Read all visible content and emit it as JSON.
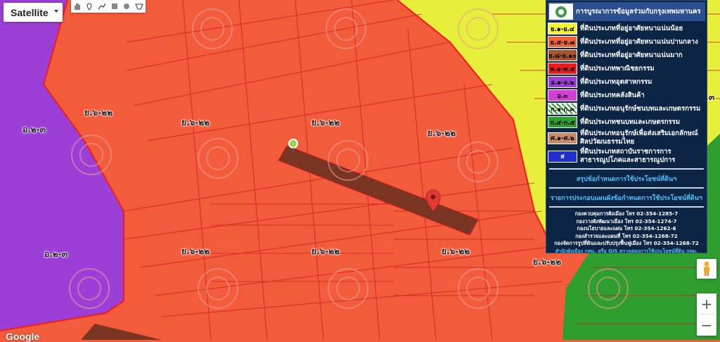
{
  "map_type": {
    "label": "Satellite"
  },
  "drawing_tools": [
    "hand-icon",
    "marker-icon",
    "polyline-icon",
    "polygon-icon",
    "circle-icon",
    "shape-icon"
  ],
  "zone_labels": [
    {
      "text": "ย.๖-๒๒",
      "id": "a"
    },
    {
      "text": "ย.๖-๒๒",
      "id": "b"
    },
    {
      "text": "ย.๖-๒๒",
      "id": "c"
    },
    {
      "text": "ย.๖-๒๒",
      "id": "d"
    },
    {
      "text": "ย.๖-๒๒",
      "id": "e"
    },
    {
      "text": "ย.๖-๒๒",
      "id": "f"
    },
    {
      "text": "ย.๖-๒๒",
      "id": "g"
    },
    {
      "text": "ย.๖-๒๒",
      "id": "h"
    },
    {
      "text": "อ.๒-๓",
      "id": "i"
    },
    {
      "text": "อ.๒-๓",
      "id": "j"
    }
  ],
  "legend": {
    "title": "การบูรณาการข้อมูลร่วมกับกรุงเทพมหานคร",
    "items": [
      {
        "code": "ย.๑-ย.๔",
        "label": "ที่ดินประเภทที่อยู่อาศัยหนาแน่นน้อย",
        "color": "#f5f23a"
      },
      {
        "code": "ย.๕-ย.๗",
        "label": "ที่ดินประเภทที่อยู่อาศัยหนาแน่นปานกลาง",
        "color": "#f0643a"
      },
      {
        "code": "ย.๘-ย.๑๐",
        "label": "ที่ดินประเภทที่อยู่อาศัยหนาแน่นมาก",
        "color": "#a8542d"
      },
      {
        "code": "พ.๑-พ.๕",
        "label": "ที่ดินประเภทพาณิชยกรรม",
        "color": "#ee1c1c"
      },
      {
        "code": "อ.๑-อ.๒",
        "label": "ที่ดินประเภทอุตสาหกรรม",
        "color": "#9b3fd6"
      },
      {
        "code": "อ.๓",
        "label": "ที่ดินประเภทคลังสินค้า",
        "color": "#d33fd6"
      },
      {
        "code": "ก.๑-ก.๓",
        "label": "ที่ดินประเภทอนุรักษ์ชนบทและเกษตรกรรม",
        "color": "#ffffff"
      },
      {
        "code": "ก.๔-ก.๕",
        "label": "ที่ดินประเภทชนบทและเกษตรกรรม",
        "color": "#2e9e2e"
      },
      {
        "code": "ศ.๑-ศ.๒",
        "label": "ที่ดินประเภทอนุรักษ์เพื่อส่งเสริมเอกลักษณ์ศิลปวัฒนธรรมไทย",
        "color": "#c98a66"
      },
      {
        "code": "ส",
        "label": "ที่ดินประเภทสถาบันราชการการสาธารณูปโภคและสาธารณูปการ",
        "color": "#1f2fd0"
      }
    ],
    "links": [
      "สรุปข้อกำหนดการใช้ประโยชน์ที่ดินฯ",
      "รายการประกอบแผนผังข้อกำหนดการใช้ประโยชน์ที่ดินฯ"
    ],
    "contacts": [
      "กองควบคุมการผังเมือง โทร 02-354-1285-7",
      "กองวางผังพัฒนาเมือง โทร 02-354-1274-7",
      "กองนโยบายและแผน โทร 02-354-1262-6",
      "กองสำรวจและแผนที่ โทร 02-354-1268-72",
      "กองจัดการรูปที่ดินและปรับปรุงฟื้นฟูเมือง โทร 02-354-1268-72"
    ],
    "footer": "สำนักผังเมือง กทม. หรือ GIS ตรวจสอบการใช้ประโยชน์ที่ดิน กทม."
  },
  "controls": {
    "zoom_in": "+",
    "zoom_out": "−"
  },
  "attribution": "Google",
  "edge_label": "๓"
}
